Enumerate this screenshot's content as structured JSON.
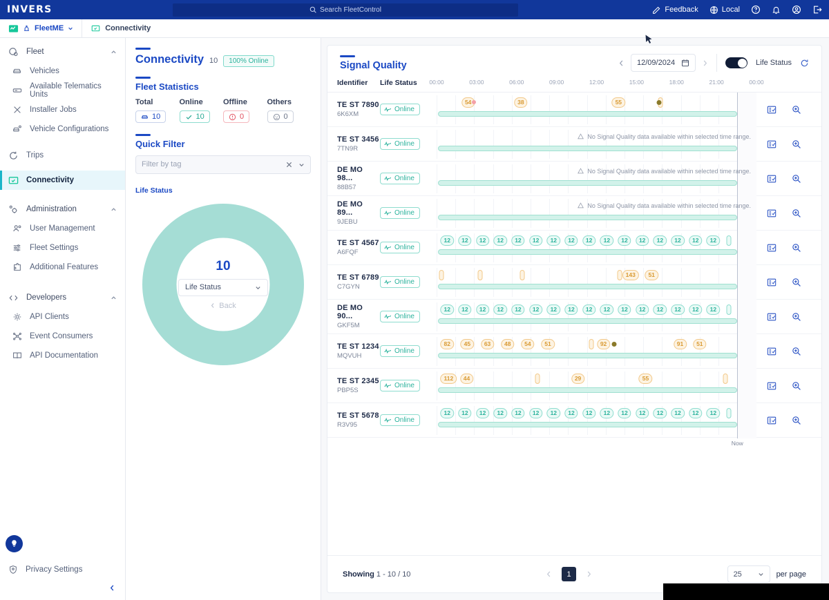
{
  "topbar": {
    "logo": "INVERS",
    "search_placeholder": "Search FleetControl",
    "items": [
      {
        "label": "Feedback",
        "icon": "edit-icon"
      },
      {
        "label": "Local",
        "icon": "globe-icon"
      },
      {
        "label": "",
        "icon": "help-circle-icon"
      },
      {
        "label": "",
        "icon": "bell-icon"
      },
      {
        "label": "",
        "icon": "account-circle-icon"
      },
      {
        "label": "",
        "icon": "logout-icon"
      }
    ]
  },
  "breadcrumb": {
    "app": "FleetME",
    "page": "Connectivity"
  },
  "sidebar": {
    "groups": [
      {
        "head": {
          "label": "Fleet",
          "icon": "fleet-icon"
        },
        "items": [
          {
            "label": "Vehicles",
            "icon": "car-icon"
          },
          {
            "label": "Available Telematics Units",
            "icon": "telematics-icon"
          },
          {
            "label": "Installer Jobs",
            "icon": "tools-icon"
          },
          {
            "label": "Vehicle Configurations",
            "icon": "vehicle-config-icon"
          }
        ]
      },
      {
        "head": null,
        "items": [
          {
            "label": "Trips",
            "icon": "trips-icon"
          }
        ]
      },
      {
        "head": null,
        "items": [
          {
            "label": "Connectivity",
            "icon": "connectivity-icon",
            "active": true
          }
        ]
      },
      {
        "head": {
          "label": "Administration",
          "icon": "admin-gear-icon"
        },
        "items": [
          {
            "label": "User Management",
            "icon": "users-icon"
          },
          {
            "label": "Fleet Settings",
            "icon": "sliders-icon"
          },
          {
            "label": "Additional Features",
            "icon": "puzzle-icon"
          }
        ]
      },
      {
        "head": {
          "label": "Developers",
          "icon": "code-icon"
        },
        "items": [
          {
            "label": "API Clients",
            "icon": "api-clients-icon"
          },
          {
            "label": "Event Consumers",
            "icon": "event-consumers-icon"
          },
          {
            "label": "API Documentation",
            "icon": "book-icon"
          }
        ]
      }
    ],
    "privacy": "Privacy Settings"
  },
  "left": {
    "title": "Connectivity",
    "count": "10",
    "online_pill": "100% Online",
    "stats_title": "Fleet Statistics",
    "stats": [
      {
        "label": "Total",
        "value": "10",
        "icon": "car-icon",
        "kind": "total"
      },
      {
        "label": "Online",
        "value": "10",
        "icon": "check-icon",
        "kind": "ok"
      },
      {
        "label": "Offline",
        "value": "0",
        "icon": "error-icon",
        "kind": "err"
      },
      {
        "label": "Others",
        "value": "0",
        "icon": "neutral-face-icon",
        "kind": "oth"
      }
    ],
    "quick_filter_title": "Quick Filter",
    "filter_placeholder": "Filter by tag",
    "life_status_label": "Life Status",
    "donut_value": "10",
    "donut_select": "Life Status",
    "donut_back": "Back"
  },
  "chart_data": {
    "type": "pie",
    "title": "Life Status",
    "categories": [
      "Online"
    ],
    "values": [
      10
    ],
    "colors": [
      "#a5ddd5"
    ],
    "center_value": 10,
    "center_label": "Life Status",
    "total": 10
  },
  "main": {
    "title": "Signal Quality",
    "date": "12/09/2024",
    "toggle_label": "Life Status",
    "refresh_icon": "refresh-icon",
    "calendar_icon": "calendar-icon",
    "columns": {
      "identifier": "Identifier",
      "life_status": "Life Status",
      "actions": ""
    },
    "time_ticks": [
      "00:00",
      "03:00",
      "06:00",
      "09:00",
      "12:00",
      "15:00",
      "18:00",
      "21:00",
      "00:00"
    ],
    "now_label": "Now",
    "no_data_text": "No Signal Quality data available within selected time range.",
    "rows": [
      {
        "id": "TE ST 7890",
        "sub": "6K6XM",
        "status": "Online",
        "marks": [
          {
            "v": "54",
            "p": 10.5
          },
          {
            "v": "",
            "p": 12.4,
            "type": "dotred"
          },
          {
            "v": "38",
            "p": 28
          },
          {
            "v": "55",
            "p": 60.5
          },
          {
            "v": "",
            "p": 74.5,
            "type": "blank"
          },
          {
            "v": "",
            "p": 74.0,
            "type": "dot"
          }
        ],
        "nodata": false
      },
      {
        "id": "TE ST 3456",
        "sub": "7TN9R",
        "status": "Online",
        "marks": [],
        "nodata": true
      },
      {
        "id": "DE MO 98...",
        "sub": "88B57",
        "status": "Online",
        "marks": [],
        "nodata": true
      },
      {
        "id": "DE MO 89...",
        "sub": "9JEBU",
        "status": "Online",
        "marks": [],
        "nodata": true
      },
      {
        "id": "TE ST 4567",
        "sub": "A6FQF",
        "status": "Online",
        "marks": [
          {
            "v": "12",
            "p": 3.5,
            "type": "teal"
          },
          {
            "v": "12",
            "p": 9.4,
            "type": "teal"
          },
          {
            "v": "12",
            "p": 15.3,
            "type": "teal"
          },
          {
            "v": "12",
            "p": 21.2,
            "type": "teal"
          },
          {
            "v": "12",
            "p": 27.1,
            "type": "teal"
          },
          {
            "v": "12",
            "p": 33.0,
            "type": "teal"
          },
          {
            "v": "12",
            "p": 38.9,
            "type": "teal"
          },
          {
            "v": "12",
            "p": 44.8,
            "type": "teal"
          },
          {
            "v": "12",
            "p": 50.7,
            "type": "teal"
          },
          {
            "v": "12",
            "p": 56.6,
            "type": "teal"
          },
          {
            "v": "12",
            "p": 62.5,
            "type": "teal"
          },
          {
            "v": "12",
            "p": 68.4,
            "type": "teal"
          },
          {
            "v": "12",
            "p": 74.3,
            "type": "teal"
          },
          {
            "v": "12",
            "p": 80.2,
            "type": "teal"
          },
          {
            "v": "12",
            "p": 86.1,
            "type": "teal"
          },
          {
            "v": "12",
            "p": 92.0,
            "type": "teal"
          },
          {
            "v": "",
            "p": 97.2,
            "type": "tealblank"
          }
        ],
        "nodata": false
      },
      {
        "id": "TE ST 6789",
        "sub": "C7GYN",
        "status": "Online",
        "marks": [
          {
            "v": "",
            "p": 1.5,
            "type": "blank"
          },
          {
            "v": "",
            "p": 14.5,
            "type": "blank"
          },
          {
            "v": "",
            "p": 28.5,
            "type": "blank"
          },
          {
            "v": "",
            "p": 61.0,
            "type": "blank"
          },
          {
            "v": "143",
            "p": 64.5
          },
          {
            "v": "51",
            "p": 71.5
          }
        ],
        "nodata": false
      },
      {
        "id": "DE MO 90...",
        "sub": "GKF5M",
        "status": "Online",
        "marks": [
          {
            "v": "12",
            "p": 3.5,
            "type": "teal"
          },
          {
            "v": "12",
            "p": 9.4,
            "type": "teal"
          },
          {
            "v": "12",
            "p": 15.3,
            "type": "teal"
          },
          {
            "v": "12",
            "p": 21.2,
            "type": "teal"
          },
          {
            "v": "12",
            "p": 27.1,
            "type": "teal"
          },
          {
            "v": "12",
            "p": 33.0,
            "type": "teal"
          },
          {
            "v": "12",
            "p": 38.9,
            "type": "teal"
          },
          {
            "v": "12",
            "p": 44.8,
            "type": "teal"
          },
          {
            "v": "12",
            "p": 50.7,
            "type": "teal"
          },
          {
            "v": "12",
            "p": 56.6,
            "type": "teal"
          },
          {
            "v": "12",
            "p": 62.5,
            "type": "teal"
          },
          {
            "v": "12",
            "p": 68.4,
            "type": "teal"
          },
          {
            "v": "12",
            "p": 74.3,
            "type": "teal"
          },
          {
            "v": "12",
            "p": 80.2,
            "type": "teal"
          },
          {
            "v": "12",
            "p": 86.1,
            "type": "teal"
          },
          {
            "v": "12",
            "p": 92.0,
            "type": "teal"
          },
          {
            "v": "",
            "p": 97.2,
            "type": "tealblank"
          }
        ],
        "nodata": false
      },
      {
        "id": "TE ST 1234",
        "sub": "MQVUH",
        "status": "Online",
        "marks": [
          {
            "v": "82",
            "p": 3.5
          },
          {
            "v": "45",
            "p": 10.2
          },
          {
            "v": "63",
            "p": 16.9
          },
          {
            "v": "48",
            "p": 23.6
          },
          {
            "v": "54",
            "p": 30.3
          },
          {
            "v": "51",
            "p": 37.0
          },
          {
            "v": "",
            "p": 51.5,
            "type": "blank"
          },
          {
            "v": "92",
            "p": 55.5
          },
          {
            "v": "",
            "p": 59.0,
            "type": "dot"
          },
          {
            "v": "91",
            "p": 81.0
          },
          {
            "v": "51",
            "p": 87.5
          }
        ],
        "nodata": false
      },
      {
        "id": "TE ST 2345",
        "sub": "PBP5S",
        "status": "Online",
        "marks": [
          {
            "v": "112",
            "p": 4.0
          },
          {
            "v": "44",
            "p": 10.0
          },
          {
            "v": "",
            "p": 33.5,
            "type": "blank"
          },
          {
            "v": "29",
            "p": 47.0
          },
          {
            "v": "55",
            "p": 69.5
          },
          {
            "v": "",
            "p": 96.0,
            "type": "blank"
          }
        ],
        "nodata": false
      },
      {
        "id": "TE ST 5678",
        "sub": "R3V95",
        "status": "Online",
        "marks": [
          {
            "v": "12",
            "p": 3.5,
            "type": "teal"
          },
          {
            "v": "12",
            "p": 9.4,
            "type": "teal"
          },
          {
            "v": "12",
            "p": 15.3,
            "type": "teal"
          },
          {
            "v": "12",
            "p": 21.2,
            "type": "teal"
          },
          {
            "v": "12",
            "p": 27.1,
            "type": "teal"
          },
          {
            "v": "12",
            "p": 33.0,
            "type": "teal"
          },
          {
            "v": "12",
            "p": 38.9,
            "type": "teal"
          },
          {
            "v": "12",
            "p": 44.8,
            "type": "teal"
          },
          {
            "v": "12",
            "p": 50.7,
            "type": "teal"
          },
          {
            "v": "12",
            "p": 56.6,
            "type": "teal"
          },
          {
            "v": "12",
            "p": 62.5,
            "type": "teal"
          },
          {
            "v": "12",
            "p": 68.4,
            "type": "teal"
          },
          {
            "v": "12",
            "p": 74.3,
            "type": "teal"
          },
          {
            "v": "12",
            "p": 80.2,
            "type": "teal"
          },
          {
            "v": "12",
            "p": 86.1,
            "type": "teal"
          },
          {
            "v": "12",
            "p": 92.0,
            "type": "teal"
          },
          {
            "v": "",
            "p": 97.2,
            "type": "tealblank"
          }
        ],
        "nodata": false
      }
    ],
    "footer": {
      "showing_label": "Showing",
      "showing_range": "1 - 10 / 10",
      "page": "1",
      "per_page_value": "25",
      "per_page_label": "per page"
    }
  }
}
